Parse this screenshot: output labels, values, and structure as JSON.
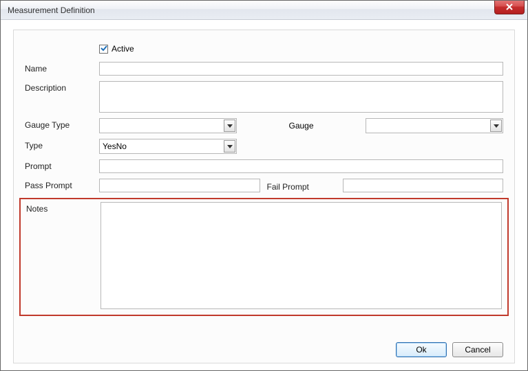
{
  "window": {
    "title": "Measurement Definition"
  },
  "form": {
    "active_label": "Active",
    "active_checked": true,
    "labels": {
      "name": "Name",
      "description": "Description",
      "gauge_type": "Gauge Type",
      "gauge": "Gauge",
      "type": "Type",
      "prompt": "Prompt",
      "pass_prompt": "Pass Prompt",
      "fail_prompt": "Fail Prompt",
      "notes": "Notes"
    },
    "values": {
      "name": "",
      "description": "",
      "gauge_type": "",
      "gauge": "",
      "type": "YesNo",
      "prompt": "",
      "pass_prompt": "",
      "fail_prompt": "",
      "notes": ""
    }
  },
  "buttons": {
    "ok": "Ok",
    "cancel": "Cancel"
  }
}
